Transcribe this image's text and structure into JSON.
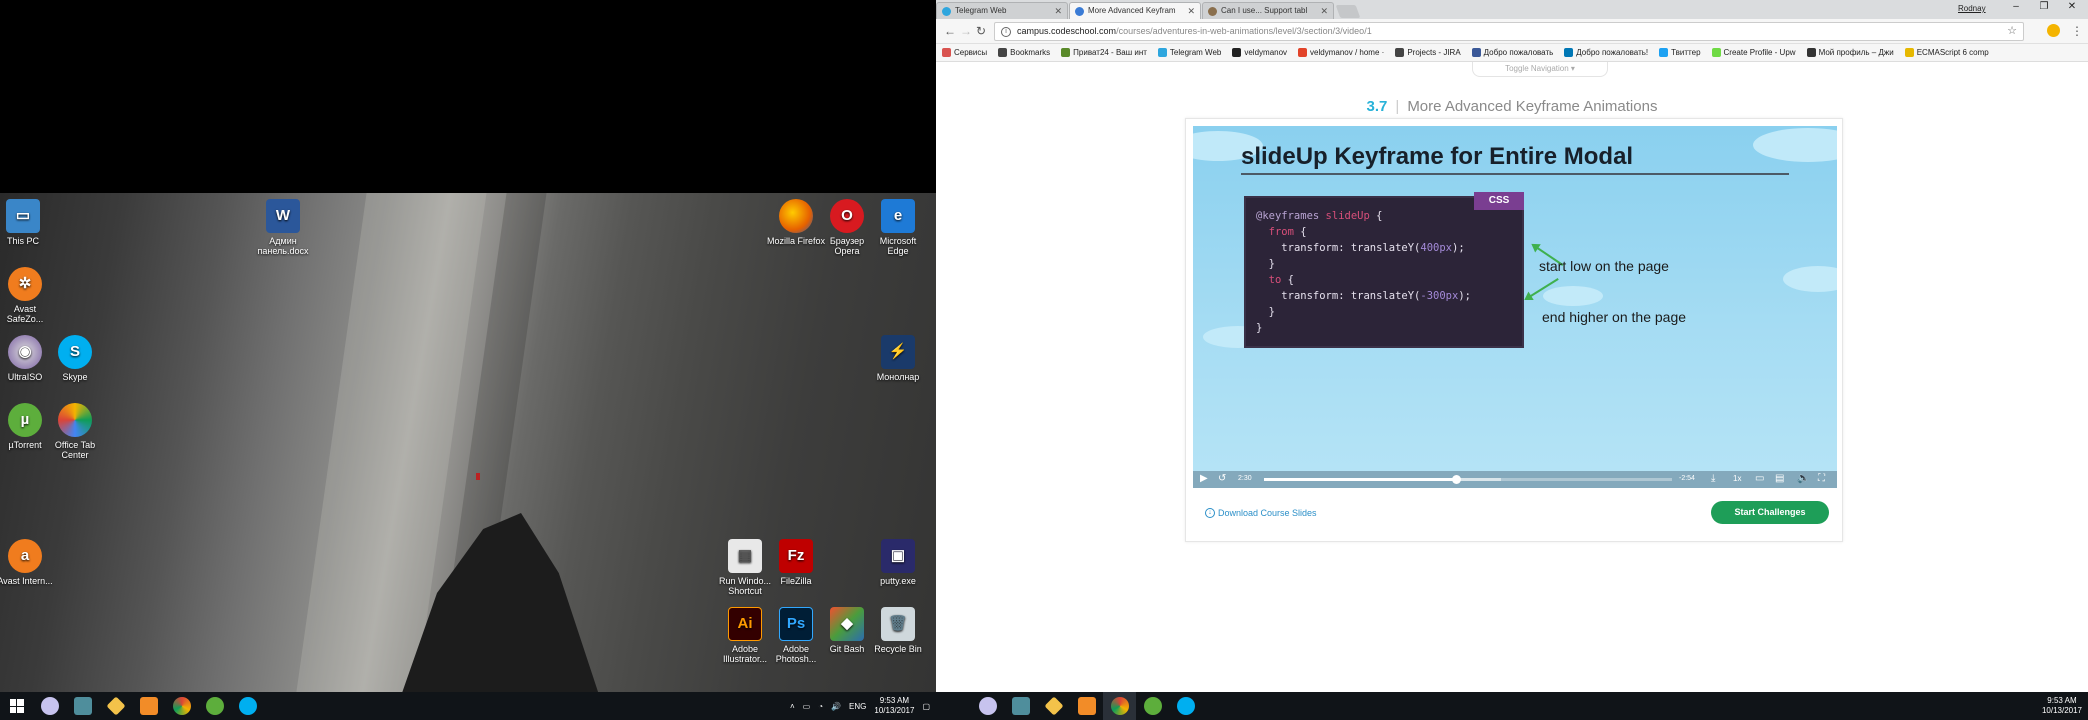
{
  "desktop": {
    "icons": [
      {
        "id": "this-pc",
        "label": "This PC"
      },
      {
        "id": "word-doc",
        "label": "Админ панель.docx"
      },
      {
        "id": "avast-safezone",
        "label": "Avast SafeZo..."
      },
      {
        "id": "ultraiso",
        "label": "UltraISO"
      },
      {
        "id": "skype",
        "label": "Skype"
      },
      {
        "id": "utorrent",
        "label": "µTorrent"
      },
      {
        "id": "office-tab-center",
        "label": "Office Tab Center"
      },
      {
        "id": "avast-internet",
        "label": "Avast Intern..."
      },
      {
        "id": "firefox",
        "label": "Mozilla Firefox"
      },
      {
        "id": "opera",
        "label": "Браузер Opera"
      },
      {
        "id": "edge",
        "label": "Microsoft Edge"
      },
      {
        "id": "monoblock",
        "label": "Монолнар"
      },
      {
        "id": "runwindow",
        "label": "Run Windo... Shortcut"
      },
      {
        "id": "filezilla",
        "label": "FileZilla"
      },
      {
        "id": "putty",
        "label": "putty.exe"
      },
      {
        "id": "illustrator",
        "label": "Adobe Illustrator..."
      },
      {
        "id": "photoshop",
        "label": "Adobe Photosh..."
      },
      {
        "id": "gitbash",
        "label": "Git Bash"
      },
      {
        "id": "recycle-bin",
        "label": "Recycle Bin"
      }
    ]
  },
  "taskbar_left": {
    "tray_lang": "ENG",
    "time": "9:53 AM",
    "date": "10/13/2017"
  },
  "taskbar_right": {
    "time": "9:53 AM",
    "date": "10/13/2017"
  },
  "browser": {
    "tabs": [
      {
        "title": "Telegram Web",
        "active": false,
        "favicon_color": "#2ea6de"
      },
      {
        "title": "More Advanced Keyfram",
        "active": true,
        "favicon_color": "#3a7bd5"
      },
      {
        "title": "Can I use... Support tabl",
        "active": false,
        "favicon_color": "#8a6f4d"
      }
    ],
    "window_user": "Rodnay",
    "url_host": "campus.codeschool.com",
    "url_path": "/courses/adventures-in-web-animations/level/3/section/3/video/1",
    "bookmarks": [
      {
        "label": "Сервисы",
        "color": "#d9534f"
      },
      {
        "label": "Bookmarks",
        "color": "#444"
      },
      {
        "label": "Приват24 - Ваш инт",
        "color": "#5a8a2a"
      },
      {
        "label": "Telegram Web",
        "color": "#2ea6de"
      },
      {
        "label": "veldymanov",
        "color": "#222"
      },
      {
        "label": "veldymanov / home ·",
        "color": "#e24329"
      },
      {
        "label": "Projects - JIRA",
        "color": "#444"
      },
      {
        "label": "Добро пожаловать",
        "color": "#3b5998"
      },
      {
        "label": "Добро пожаловать!",
        "color": "#0077b5"
      },
      {
        "label": "Твиттер",
        "color": "#1da1f2"
      },
      {
        "label": "Create Profile - Upw",
        "color": "#6fda44"
      },
      {
        "label": "Мой профиль – Джи",
        "color": "#333"
      },
      {
        "label": "ECMAScript 6 comp",
        "color": "#e6b800"
      }
    ]
  },
  "page": {
    "toggle_nav": "Toggle Navigation",
    "section_number": "3.7",
    "section_title": "More Advanced Keyframe Animations",
    "slide": {
      "title": "slideUp Keyframe for Entire Modal",
      "lang_tag": "CSS",
      "code": {
        "line1_at": "@keyframes",
        "line1_name": "slideUp",
        "line1_brace": "{",
        "line2_kw": "from",
        "line2_brace": "{",
        "line3_prop": "transform:",
        "line3_fn": "translateY(",
        "line3_num": "400px",
        "line3_end": ");",
        "line4": "}",
        "line5_kw": "to",
        "line5_brace": "{",
        "line6_prop": "transform:",
        "line6_fn": "translateY(",
        "line6_num": "-300px",
        "line6_end": ");",
        "line7": "}",
        "line8": "}"
      },
      "annotation_1": "start low on the page",
      "annotation_2": "end higher on the page"
    },
    "video": {
      "elapsed": "2:30",
      "remaining": "-2:54",
      "speed": "1x",
      "progress": 0.47,
      "buffered": 0.58
    },
    "download_link": "Download Course Slides",
    "start_button": "Start Challenges"
  }
}
